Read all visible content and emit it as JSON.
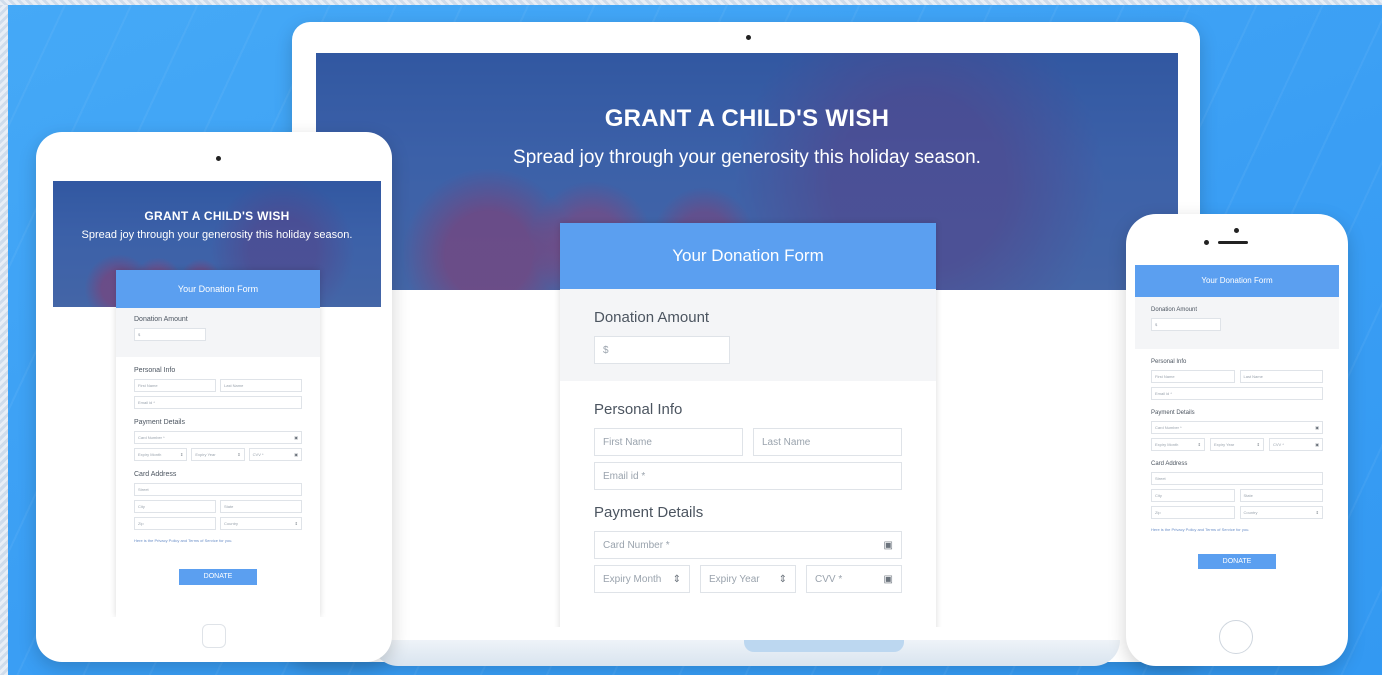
{
  "hero": {
    "title": "GRANT A CHILD'S WISH",
    "subtitle": "Spread joy through your generosity this holiday season."
  },
  "form": {
    "header": "Your Donation Form",
    "donation_amount_label": "Donation Amount",
    "currency_symbol": "$",
    "personal_info_label": "Personal Info",
    "first_name_placeholder": "First Name",
    "last_name_placeholder": "Last Name",
    "email_placeholder": "Email id *",
    "payment_details_label": "Payment Details",
    "card_number_placeholder": "Card Number *",
    "expiry_month_placeholder": "Expiry Month",
    "expiry_year_placeholder": "Expiry Year",
    "cvv_placeholder": "CVV *",
    "card_address_label": "Card Address",
    "street_placeholder": "Street",
    "city_placeholder": "City",
    "state_placeholder": "State",
    "zip_placeholder": "Zip",
    "country_placeholder": "Country",
    "agree_text": "Here is the Privacy Policy and Terms of Service for you.",
    "donate_label": "DONATE"
  },
  "icons": {
    "card": "card-icon",
    "stepper": "stepper-icon"
  },
  "colors": {
    "background": "#3ea2f5",
    "accent": "#5b9ff0",
    "hero_overlay": "#3a5fa3"
  }
}
